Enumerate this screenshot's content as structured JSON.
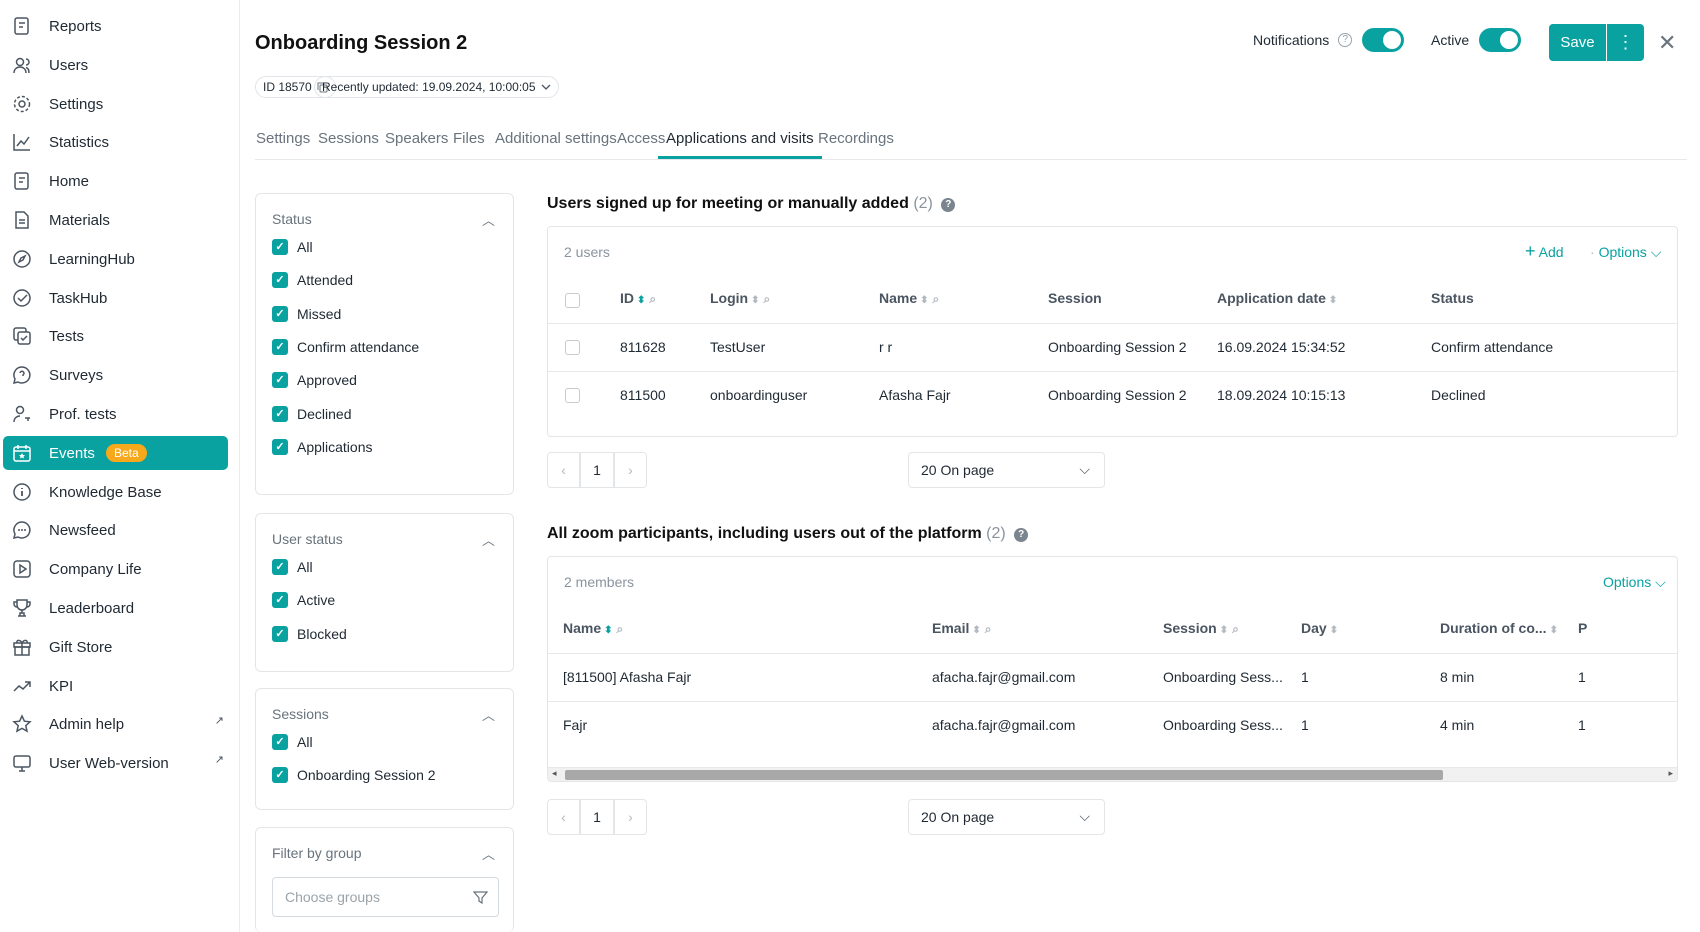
{
  "sidebar": {
    "items": [
      {
        "label": "Reports",
        "icon": "reports-icon"
      },
      {
        "label": "Users",
        "icon": "users-icon"
      },
      {
        "label": "Settings",
        "icon": "gear-icon"
      },
      {
        "label": "Statistics",
        "icon": "chart-icon"
      },
      {
        "label": "Home",
        "icon": "home-icon"
      },
      {
        "label": "Materials",
        "icon": "document-icon"
      },
      {
        "label": "LearningHub",
        "icon": "compass-icon"
      },
      {
        "label": "TaskHub",
        "icon": "check-circle-icon"
      },
      {
        "label": "Tests",
        "icon": "tests-icon"
      },
      {
        "label": "Surveys",
        "icon": "speech-bubble-icon"
      },
      {
        "label": "Prof. tests",
        "icon": "person-key-icon"
      },
      {
        "label": "Events",
        "icon": "calendar-icon",
        "badge": "Beta"
      },
      {
        "label": "Knowledge Base",
        "icon": "info-icon"
      },
      {
        "label": "Newsfeed",
        "icon": "chat-icon"
      },
      {
        "label": "Company Life",
        "icon": "play-icon"
      },
      {
        "label": "Leaderboard",
        "icon": "trophy-icon"
      },
      {
        "label": "Gift Store",
        "icon": "gift-icon"
      },
      {
        "label": "KPI",
        "icon": "trend-icon"
      },
      {
        "label": "Admin help",
        "icon": "star-icon",
        "external": "↗"
      },
      {
        "label": "User Web-version",
        "icon": "monitor-icon",
        "external": "↗"
      }
    ]
  },
  "header": {
    "title": "Onboarding Session 2",
    "id_chip": "ID 18570",
    "updated_chip": "Recently updated: 19.09.2024, 10:00:05",
    "notifications_label": "Notifications",
    "active_label": "Active",
    "save_label": "Save"
  },
  "tabs": [
    "Settings",
    "Sessions",
    "Speakers",
    "Files",
    "Additional settings",
    "Access",
    "Applications and visits",
    "Recordings"
  ],
  "filters": {
    "status": {
      "title": "Status",
      "options": [
        "All",
        "Attended",
        "Missed",
        "Confirm attendance",
        "Approved",
        "Declined",
        "Applications"
      ]
    },
    "user_status": {
      "title": "User status",
      "options": [
        "All",
        "Active",
        "Blocked"
      ]
    },
    "sessions": {
      "title": "Sessions",
      "options": [
        "All",
        "Onboarding Session 2"
      ]
    },
    "group": {
      "title": "Filter by group",
      "placeholder": "Choose groups"
    }
  },
  "signed_up": {
    "title": "Users signed up for meeting or manually added",
    "count": "(2)",
    "count_text": "2 users",
    "add_label": "Add",
    "options_label": "Options",
    "columns": [
      "ID",
      "Login",
      "Name",
      "Session",
      "Application date",
      "Status"
    ],
    "rows": [
      [
        "811628",
        "TestUser",
        "r r",
        "Onboarding Session 2",
        "16.09.2024 15:34:52",
        "Confirm attendance"
      ],
      [
        "811500",
        "onboardinguser",
        "Afasha Fajr",
        "Onboarding Session 2",
        "18.09.2024 10:15:13",
        "Declined"
      ]
    ],
    "page": "1",
    "per_page": "20 On page"
  },
  "zoom": {
    "title": "All zoom participants, including users out of the platform",
    "count": "(2)",
    "count_text": "2 members",
    "options_label": "Options",
    "columns": [
      "Name",
      "Email",
      "Session",
      "Day",
      "Duration of co...",
      "P"
    ],
    "rows": [
      [
        "[811500] Afasha Fajr",
        "afacha.fajr@gmail.com",
        "Onboarding Sess...",
        "1",
        "8 min",
        "1"
      ],
      [
        "Fajr",
        "afacha.fajr@gmail.com",
        "Onboarding Sess...",
        "1",
        "4 min",
        "1"
      ]
    ],
    "page": "1",
    "per_page": "20 On page"
  },
  "colors": {
    "accent": "#0aa1a1",
    "badge": "#f7a81b"
  }
}
